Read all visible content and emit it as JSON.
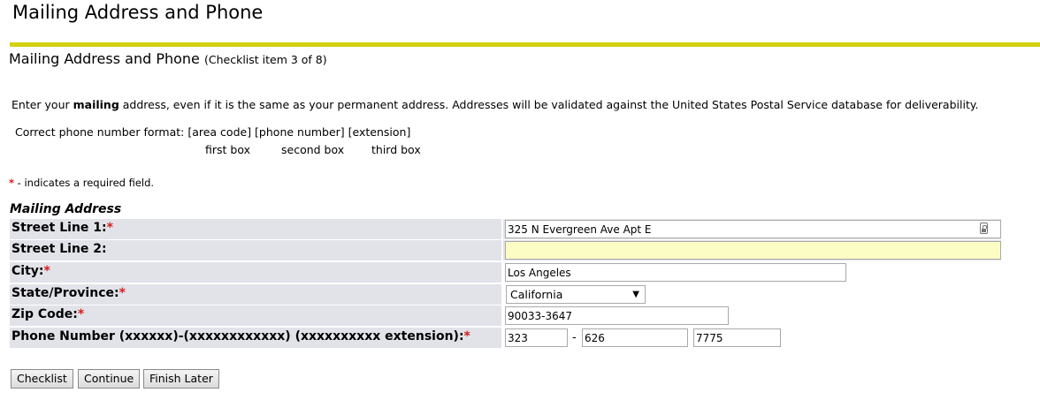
{
  "page": {
    "title": "Mailing Address and Phone",
    "subtitle": "Mailing Address and Phone",
    "checklist_note": "(Checklist item 3 of 8)",
    "intro_prefix": "Enter your ",
    "intro_bold": "mailing",
    "intro_suffix": " address, even if it is the same as your permanent address. Addresses will be validated against the United States Postal Service database for deliverability.",
    "phone_format": "Correct phone number format: [area code] [phone number] [extension]",
    "phone_box_1": "first box",
    "phone_box_2": "second box",
    "phone_box_3": "third box",
    "required_star": "*",
    "required_note": " - indicates a required field.",
    "accent_color": "#d2d10f"
  },
  "form": {
    "section_caption": "Mailing Address",
    "street1_label": "Street Line 1:",
    "street1_value": "325 N Evergreen Ave Apt E",
    "street2_label": "Street Line 2:",
    "street2_value": "",
    "city_label": "City:",
    "city_value": "Los Angeles",
    "state_label": "State/Province:",
    "state_value": "California",
    "zip_label": "Zip Code:",
    "zip_value": "90033-3647",
    "phone_label": "Phone Number (xxxxxx)-(xxxxxxxxxxxx) (xxxxxxxxxx extension):",
    "phone_area": "323",
    "phone_separator": "-",
    "phone_number": "626",
    "phone_extension": "7775",
    "star": "*"
  },
  "buttons": {
    "checklist": "Checklist",
    "continue": "Continue",
    "finish_later": "Finish Later"
  },
  "icons": {
    "autofill": "autofill-key-icon",
    "dropdown": "chevron-down-icon"
  }
}
